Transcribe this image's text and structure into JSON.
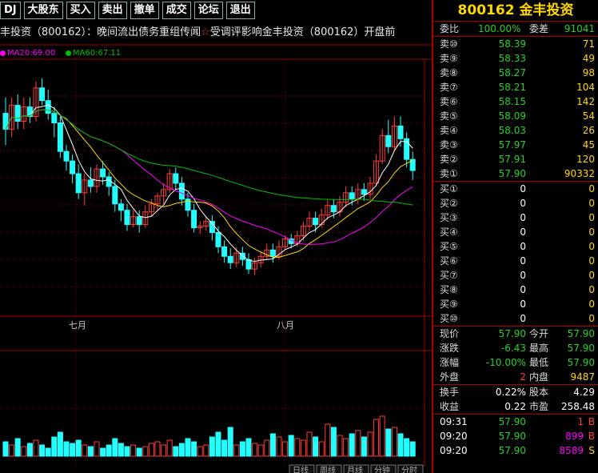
{
  "toolbar": {
    "items": [
      {
        "label": "DJ",
        "name": "dj-button"
      },
      {
        "label": "大股东",
        "name": "major-shareholder-button"
      },
      {
        "label": "买入",
        "name": "buy-button"
      },
      {
        "label": "卖出",
        "name": "sell-button"
      },
      {
        "label": "撤单",
        "name": "cancel-order-button"
      },
      {
        "label": "成交",
        "name": "deals-button"
      },
      {
        "label": "论坛",
        "name": "forum-button"
      },
      {
        "label": "退出",
        "name": "exit-button"
      }
    ]
  },
  "ticker": {
    "text1": "丰投资（800162）：晚间流出债务重组传闻",
    "star": "☆",
    "text2": "受调评影响金丰投资（800162）开盘前"
  },
  "ma_legend": {
    "ma20": "MA20:69.00",
    "ma60": "MA60:67.11",
    "ma20_color": "#ff00ff",
    "ma60_color": "#00c000"
  },
  "chart": {
    "month_labels": [
      "七月",
      "八月"
    ],
    "bottom_tabs": [
      "日线",
      "周线",
      "月线",
      "分钟",
      "分时"
    ]
  },
  "stock": {
    "code": "800162",
    "name": "金丰投资",
    "weibi_label": "委比",
    "weibi": "100.00%",
    "weicha_label": "委差",
    "weicha": "91041"
  },
  "sell_orders": [
    {
      "label": "卖⑩",
      "price": "58.39",
      "vol": "71"
    },
    {
      "label": "卖⑨",
      "price": "58.33",
      "vol": "49"
    },
    {
      "label": "卖⑧",
      "price": "58.27",
      "vol": "98"
    },
    {
      "label": "卖⑦",
      "price": "58.21",
      "vol": "104"
    },
    {
      "label": "卖⑥",
      "price": "58.15",
      "vol": "142"
    },
    {
      "label": "卖⑤",
      "price": "58.09",
      "vol": "54"
    },
    {
      "label": "卖④",
      "price": "58.03",
      "vol": "26"
    },
    {
      "label": "卖③",
      "price": "57.97",
      "vol": "45"
    },
    {
      "label": "卖②",
      "price": "57.91",
      "vol": "120"
    },
    {
      "label": "卖①",
      "price": "57.90",
      "vol": "90332"
    }
  ],
  "buy_orders": [
    {
      "label": "买①",
      "price": "0",
      "vol": "0"
    },
    {
      "label": "买②",
      "price": "0",
      "vol": "0"
    },
    {
      "label": "买③",
      "price": "0",
      "vol": "0"
    },
    {
      "label": "买④",
      "price": "0",
      "vol": "0"
    },
    {
      "label": "买⑤",
      "price": "0",
      "vol": "0"
    },
    {
      "label": "买⑥",
      "price": "0",
      "vol": "0"
    },
    {
      "label": "买⑦",
      "price": "0",
      "vol": "0"
    },
    {
      "label": "买⑧",
      "price": "0",
      "vol": "0"
    },
    {
      "label": "买⑨",
      "price": "0",
      "vol": "0"
    },
    {
      "label": "买⑩",
      "price": "0",
      "vol": "0"
    }
  ],
  "quote": {
    "rows": [
      {
        "l1": "现价",
        "v1": "57.90",
        "l2": "今开",
        "v2": "57.90"
      },
      {
        "l1": "涨跌",
        "v1": "-6.43",
        "l2": "最高",
        "v2": "57.90"
      },
      {
        "l1": "涨幅",
        "v1": "-10.00%",
        "l2": "最低",
        "v2": "57.90"
      },
      {
        "l1": "外盘",
        "v1": "2",
        "l2": "内盘",
        "v2": "9487"
      }
    ],
    "rows2": [
      {
        "l1": "换手",
        "v1": "0.22%",
        "l2": "股本",
        "v2": "4.29"
      },
      {
        "l1": "收益",
        "v1": "0.22",
        "l2": "市盈",
        "v2": "258.48"
      }
    ]
  },
  "trades": [
    {
      "time": "09:31",
      "price": "57.90",
      "vol": "1",
      "side": "B"
    },
    {
      "time": "09:20",
      "price": "57.90",
      "vol": "899",
      "side": "B"
    },
    {
      "time": "09:20",
      "price": "57.90",
      "vol": "8589",
      "side": "S"
    }
  ],
  "colors": {
    "up": "#ff3b3b",
    "down": "#2ff",
    "ma5": "#ffffff",
    "ma10": "#ffd800",
    "ma20": "#ff00ff",
    "ma60": "#00c000",
    "grid": "#a00000"
  }
}
